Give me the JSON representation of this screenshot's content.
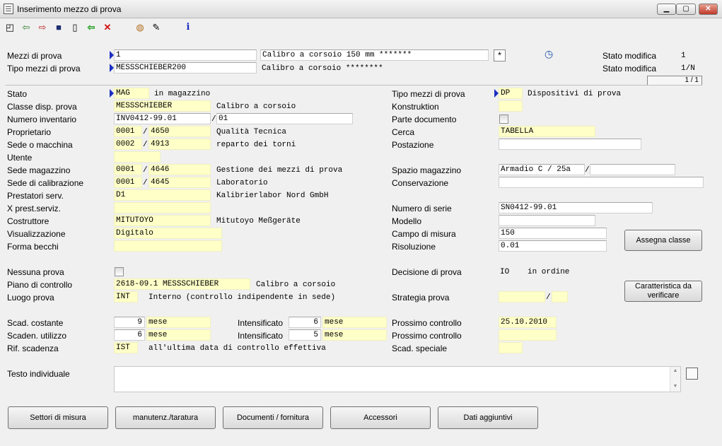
{
  "window": {
    "title": "Inserimento mezzo di prova",
    "min": "▁",
    "max": "▢",
    "close": "✕"
  },
  "toolbar": {
    "icons": [
      "◰",
      "⇦",
      "⇨",
      "■",
      "▯",
      "⇦",
      "✕",
      "◍",
      "✎",
      "i"
    ]
  },
  "header": {
    "mezzi_label": "Mezzi di prova",
    "mezzi_value": "1",
    "mezzi_desc": "Calibro a corsoio 150 mm *******",
    "star": "*",
    "tipo_label": "Tipo mezzi di prova",
    "tipo_value": "MESSSCHIEBER200",
    "tipo_desc": "Calibro a corsoio ********",
    "stato_mod_label1": "Stato modifica",
    "stato_mod_val1": "1",
    "stato_mod_label2": "Stato modifica",
    "stato_mod_val2": "1/N",
    "page": "1 / 1"
  },
  "left": {
    "stato": {
      "label": "Stato",
      "value": "MAG",
      "desc": "in magazzino"
    },
    "classe": {
      "label": "Classe disp. prova",
      "value": "MESSSCHIEBER",
      "desc": "Calibro a corsoio"
    },
    "inventario": {
      "label": "Numero inventario",
      "value": "INV0412-99.01",
      "suffix": "01"
    },
    "proprietario": {
      "label": "Proprietario",
      "v1": "0001",
      "v2": "4650",
      "desc": "Qualità Tecnica"
    },
    "sede": {
      "label": "Sede o macchina",
      "v1": "0002",
      "v2": "4913",
      "desc": "reparto dei torni"
    },
    "utente": {
      "label": "Utente"
    },
    "sede_mag": {
      "label": "Sede magazzino",
      "v1": "0001",
      "v2": "4646",
      "desc": "Gestione dei mezzi di prova"
    },
    "sede_cal": {
      "label": "Sede di calibrazione",
      "v1": "0001",
      "v2": "4645",
      "desc": "Laboratorio"
    },
    "prestatori": {
      "label": "Prestatori serv.",
      "value": "D1",
      "desc": "Kalibrierlabor Nord GmbH"
    },
    "xprest": {
      "label": "X prest.serviz."
    },
    "costruttore": {
      "label": "Costruttore",
      "value": "MITUTOYO",
      "desc": "Mitutoyo Meßgeräte"
    },
    "visualizzazione": {
      "label": "Visualizzazione",
      "value": "Digitalo"
    },
    "forma": {
      "label": "Forma becchi"
    },
    "nessuna": {
      "label": "Nessuna prova"
    },
    "piano": {
      "label": "Piano di controllo",
      "value": "2618-09.1 MESSSCHIEBER",
      "desc": "Calibro a corsoio"
    },
    "luogo": {
      "label": "Luogo prova",
      "value": "INT",
      "desc": "Interno (controllo indipendente in sede)"
    },
    "scad_cost": {
      "label": "Scad. costante",
      "value": "9",
      "unit": "mese",
      "int_label": "Intensificato",
      "int_value": "6",
      "int_unit": "mese"
    },
    "scad_util": {
      "label": "Scaden. utilizzo",
      "value": "6",
      "unit": "mese",
      "int_label": "Intensificato",
      "int_value": "5",
      "int_unit": "mese"
    },
    "rif": {
      "label": "Rif. scadenza",
      "value": "IST",
      "desc": "all'ultima data di controllo effettiva"
    },
    "testo": {
      "label": "Testo individuale"
    }
  },
  "right": {
    "tipo": {
      "label": "Tipo mezzi di prova",
      "value": "DP",
      "desc": "Dispositivi di prova"
    },
    "konstruktion": {
      "label": "Konstruktion"
    },
    "parte": {
      "label": "Parte documento"
    },
    "cerca": {
      "label": "Cerca",
      "value": "TABELLA"
    },
    "postazione": {
      "label": "Postazione"
    },
    "spazio": {
      "label": "Spazio magazzino",
      "value": "Armadio C / 25a"
    },
    "conservazione": {
      "label": "Conservazione"
    },
    "serie": {
      "label": "Numero di serie",
      "value": "SN0412-99.01"
    },
    "modello": {
      "label": "Modello"
    },
    "campo": {
      "label": "Campo di misura",
      "value": "150"
    },
    "risoluzione": {
      "label": "Risoluzione",
      "value": "0.01"
    },
    "decisione": {
      "label": "Decisione di prova",
      "value": "IO",
      "desc": "in ordine"
    },
    "strategia": {
      "label": "Strategia prova"
    },
    "prossimo1": {
      "label": "Prossimo controllo",
      "value": "25.10.2010"
    },
    "prossimo2": {
      "label": "Prossimo controllo"
    },
    "speciale": {
      "label": "Scad. speciale"
    },
    "assegna": "Assegna classe",
    "caratteristica": "Caratteristica da verificare"
  },
  "bottom_buttons": [
    "Settori di misura",
    "manutenz./taratura",
    "Documenti / fornitura",
    "Accessori",
    "Dati aggiuntivi"
  ],
  "colors": {
    "field_yellow": "#ffffc8",
    "arrow_blue": "#1a2fc0"
  }
}
